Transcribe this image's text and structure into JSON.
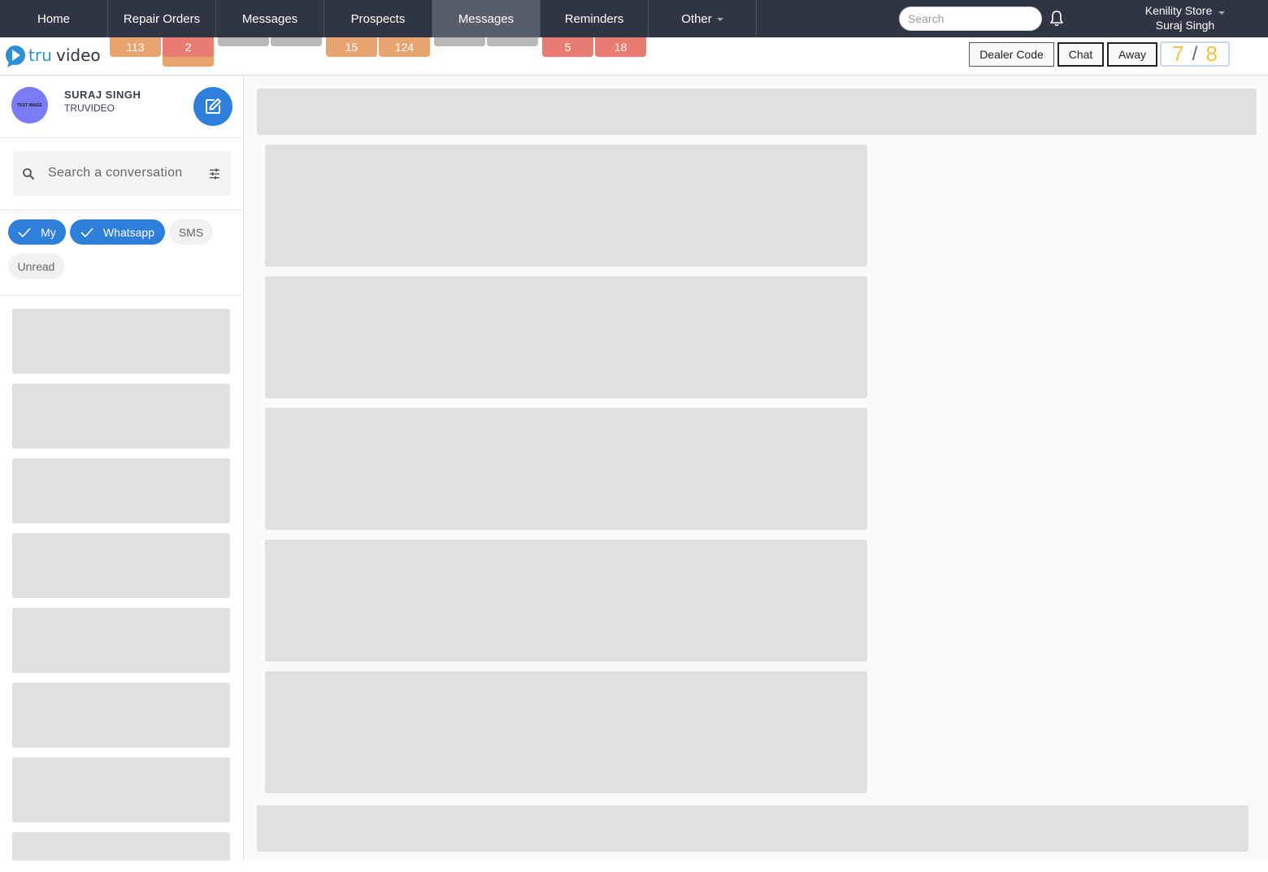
{
  "nav": {
    "tabs": [
      {
        "label": "Home"
      },
      {
        "label": "Repair Orders"
      },
      {
        "label": "Messages"
      },
      {
        "label": "Prospects"
      },
      {
        "label": "Messages"
      },
      {
        "label": "Reminders"
      },
      {
        "label": "Other"
      }
    ],
    "active_tab": "Messages",
    "search_placeholder": "Search",
    "store": "Kenility Store",
    "user": "Suraj Singh"
  },
  "badges": [
    "113",
    "2",
    "15",
    "124",
    "5",
    "18"
  ],
  "header": {
    "dealer_code_label": "Dealer Code",
    "chat_label": "Chat",
    "away_label": "Away",
    "ratio_left": "7",
    "ratio_sep": "/",
    "ratio_right": "8"
  },
  "sidebar": {
    "avatar_text": "TEST IMAGE",
    "user_name": "SURAJ SINGH",
    "user_org": "TRUVIDEO",
    "search_placeholder": "Search a conversation",
    "filters": [
      {
        "label": "My",
        "selected": true
      },
      {
        "label": "Whatsapp",
        "selected": true
      },
      {
        "label": "SMS",
        "selected": false
      },
      {
        "label": "Unread",
        "selected": false
      }
    ]
  },
  "colors": {
    "navbar": "#2f3542",
    "accent": "#2d7fd9",
    "badge_orange": "#e8a46f",
    "badge_red": "#e87c72",
    "ratio": "#f5c33b",
    "skeleton": "#e0e0e0"
  },
  "icons": [
    "bell-icon",
    "search-icon",
    "filter-icon",
    "compose-icon",
    "check-icon",
    "truvideo-logo"
  ]
}
